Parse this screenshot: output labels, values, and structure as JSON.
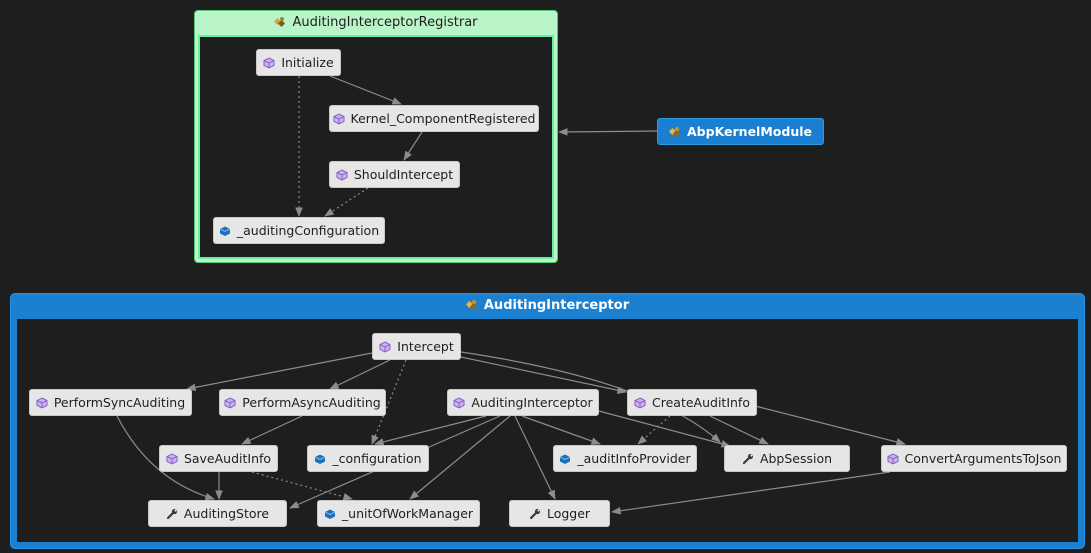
{
  "groups": {
    "registrar": {
      "title": "AuditingInterceptorRegistrar"
    },
    "interceptor": {
      "title": "AuditingInterceptor"
    }
  },
  "nodes": {
    "initialize": "Initialize",
    "kernel_component_registered": "Kernel_ComponentRegistered",
    "should_intercept": "ShouldIntercept",
    "auditing_configuration": "_auditingConfiguration",
    "abp_kernel_module": "AbpKernelModule",
    "intercept": "Intercept",
    "perform_sync_auditing": "PerformSyncAuditing",
    "perform_async_auditing": "PerformAsyncAuditing",
    "auditing_interceptor_ctor": "AuditingInterceptor",
    "create_audit_info": "CreateAuditInfo",
    "save_audit_info": "SaveAuditInfo",
    "configuration": "_configuration",
    "audit_info_provider": "_auditInfoProvider",
    "abp_session": "AbpSession",
    "convert_arguments_to_json": "ConvertArgumentsToJson",
    "auditing_store": "AuditingStore",
    "unit_of_work_manager": "_unitOfWorkManager",
    "logger": "Logger"
  },
  "colors": {
    "background": "#1e1e1e",
    "edge": "#8c8c8c",
    "registrar_frame": "#b9f5c9",
    "interceptor_frame": "#1c80d0",
    "node_fill": "#e6e6e6",
    "external_node": "#1b7fd1",
    "method_icon": "#8a5fc8",
    "field_icon": "#1c6fb8"
  },
  "icons": {
    "class": "class-icon",
    "method": "method-icon",
    "field": "field-icon",
    "property": "wrench-icon"
  }
}
